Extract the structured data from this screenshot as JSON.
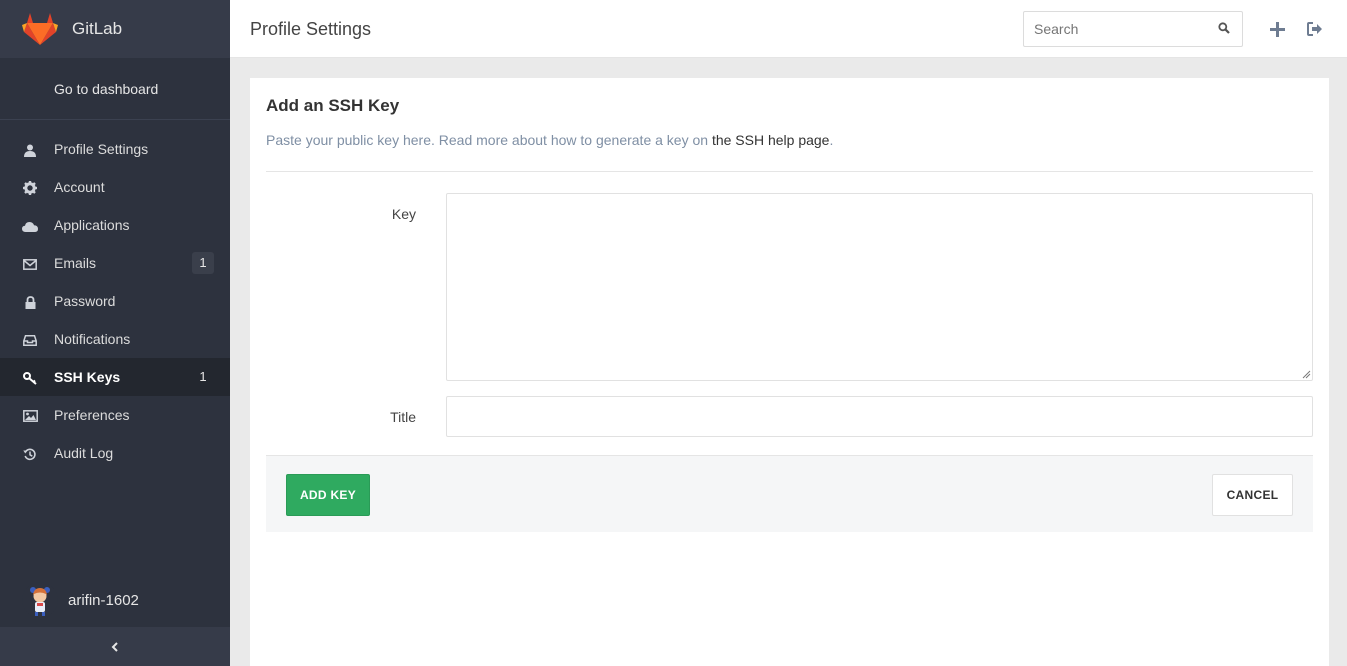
{
  "brand": {
    "name": "GitLab",
    "logo_icon": "gitlab-fox-icon"
  },
  "sidebar": {
    "dashboard_link": "Go to dashboard",
    "items": [
      {
        "label": "Profile Settings",
        "icon": "user-icon",
        "badge": ""
      },
      {
        "label": "Account",
        "icon": "gear-icon",
        "badge": ""
      },
      {
        "label": "Applications",
        "icon": "cloud-icon",
        "badge": ""
      },
      {
        "label": "Emails",
        "icon": "envelope-icon",
        "badge": "1"
      },
      {
        "label": "Password",
        "icon": "lock-icon",
        "badge": ""
      },
      {
        "label": "Notifications",
        "icon": "inbox-icon",
        "badge": ""
      },
      {
        "label": "SSH Keys",
        "icon": "key-icon",
        "badge": "1",
        "active": true
      },
      {
        "label": "Preferences",
        "icon": "image-icon",
        "badge": ""
      },
      {
        "label": "Audit Log",
        "icon": "history-icon",
        "badge": ""
      }
    ],
    "user": {
      "name": "arifin-1602"
    },
    "collapse_icon": "chevron-left-icon"
  },
  "header": {
    "title": "Profile Settings",
    "search_placeholder": "Search"
  },
  "main": {
    "title": "Add an SSH Key",
    "description": "Paste your public key here. Read more about how to generate a key on ",
    "help_link": "the SSH help page",
    "description_end": ".",
    "key_label": "Key",
    "key_value": "",
    "title_label": "Title",
    "title_value": "",
    "add_button": "ADD KEY",
    "cancel_button": "CANCEL"
  },
  "colors": {
    "sidebar_bg": "#2d323e",
    "active_item_bg": "#23272f",
    "accent_green": "#2faa60",
    "link_muted": "#7f8fa4"
  }
}
